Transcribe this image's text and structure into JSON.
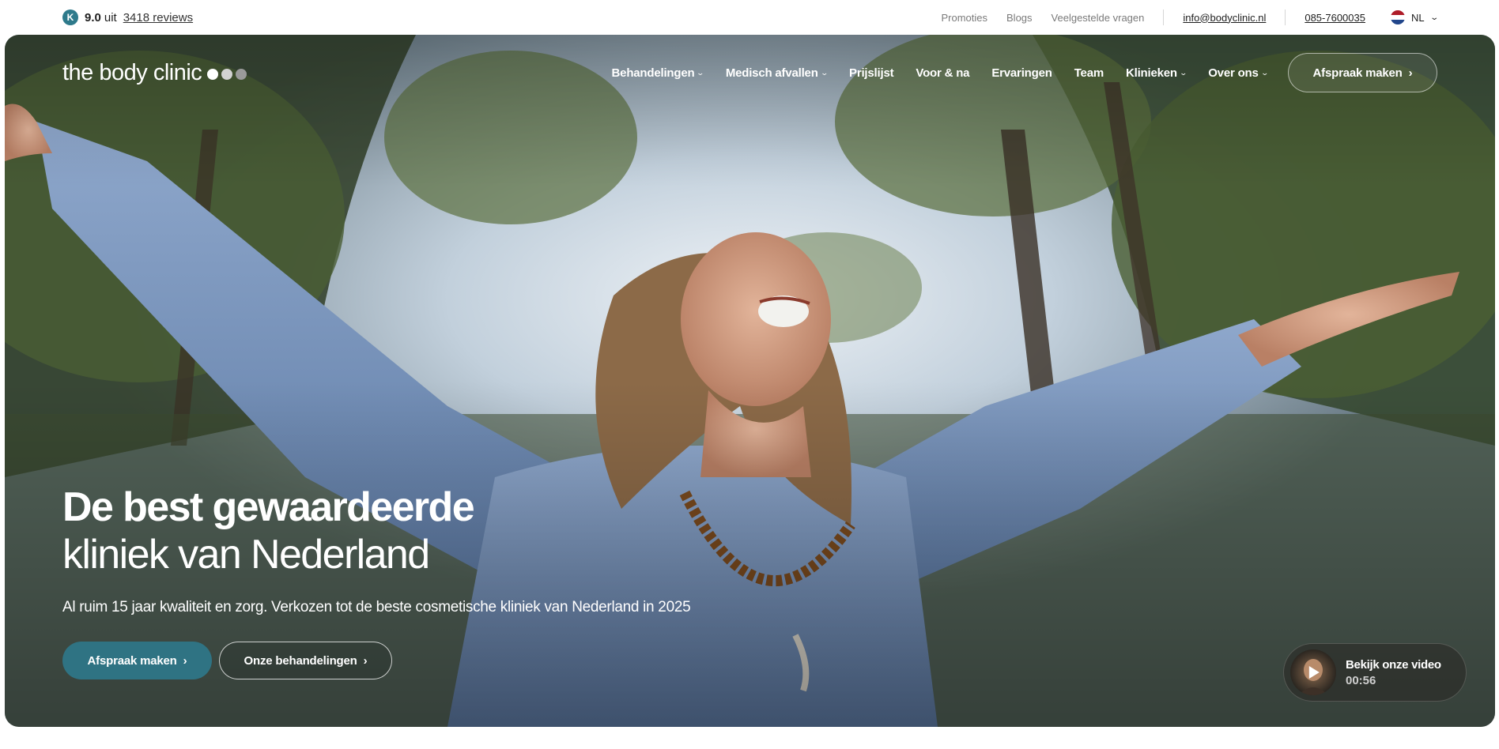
{
  "topbar": {
    "rating_icon": "kiyoh-k-icon",
    "rating_badge_letter": "K",
    "score": "9.0",
    "score_suffix": "uit",
    "reviews_link": "3418 reviews",
    "links": [
      "Promoties",
      "Blogs",
      "Veelgestelde vragen"
    ],
    "email": "info@bodyclinic.nl",
    "phone": "085-7600035",
    "language": "NL",
    "language_icon": "netherlands-flag-icon"
  },
  "nav": {
    "logo": "the body clinic",
    "logo_dot_colors": [
      "#ffffff",
      "#d2d2d2",
      "#9a9a9a"
    ],
    "items": [
      {
        "label": "Behandelingen",
        "dropdown": true
      },
      {
        "label": "Medisch afvallen",
        "dropdown": true
      },
      {
        "label": "Prijslijst",
        "dropdown": false
      },
      {
        "label": "Voor & na",
        "dropdown": false
      },
      {
        "label": "Ervaringen",
        "dropdown": false
      },
      {
        "label": "Team",
        "dropdown": false
      },
      {
        "label": "Klinieken",
        "dropdown": true
      },
      {
        "label": "Over ons",
        "dropdown": true
      }
    ],
    "cta": "Afspraak maken"
  },
  "hero": {
    "title_line1": "De best gewaardeerde",
    "title_line2": "kliniek van Nederland",
    "subtitle": "Al ruim 15 jaar kwaliteit en zorg. Verkozen tot de beste cosmetische kliniek van Nederland in 2025",
    "primary_button": "Afspraak maken",
    "secondary_button": "Onze behandelingen",
    "video": {
      "label": "Bekijk onze video",
      "duration": "00:56"
    }
  },
  "colors": {
    "brand_teal": "#2f7383",
    "badge_teal": "#2e7a8b",
    "text_dark": "#1e1e1e",
    "text_muted": "#7a7a7a"
  }
}
